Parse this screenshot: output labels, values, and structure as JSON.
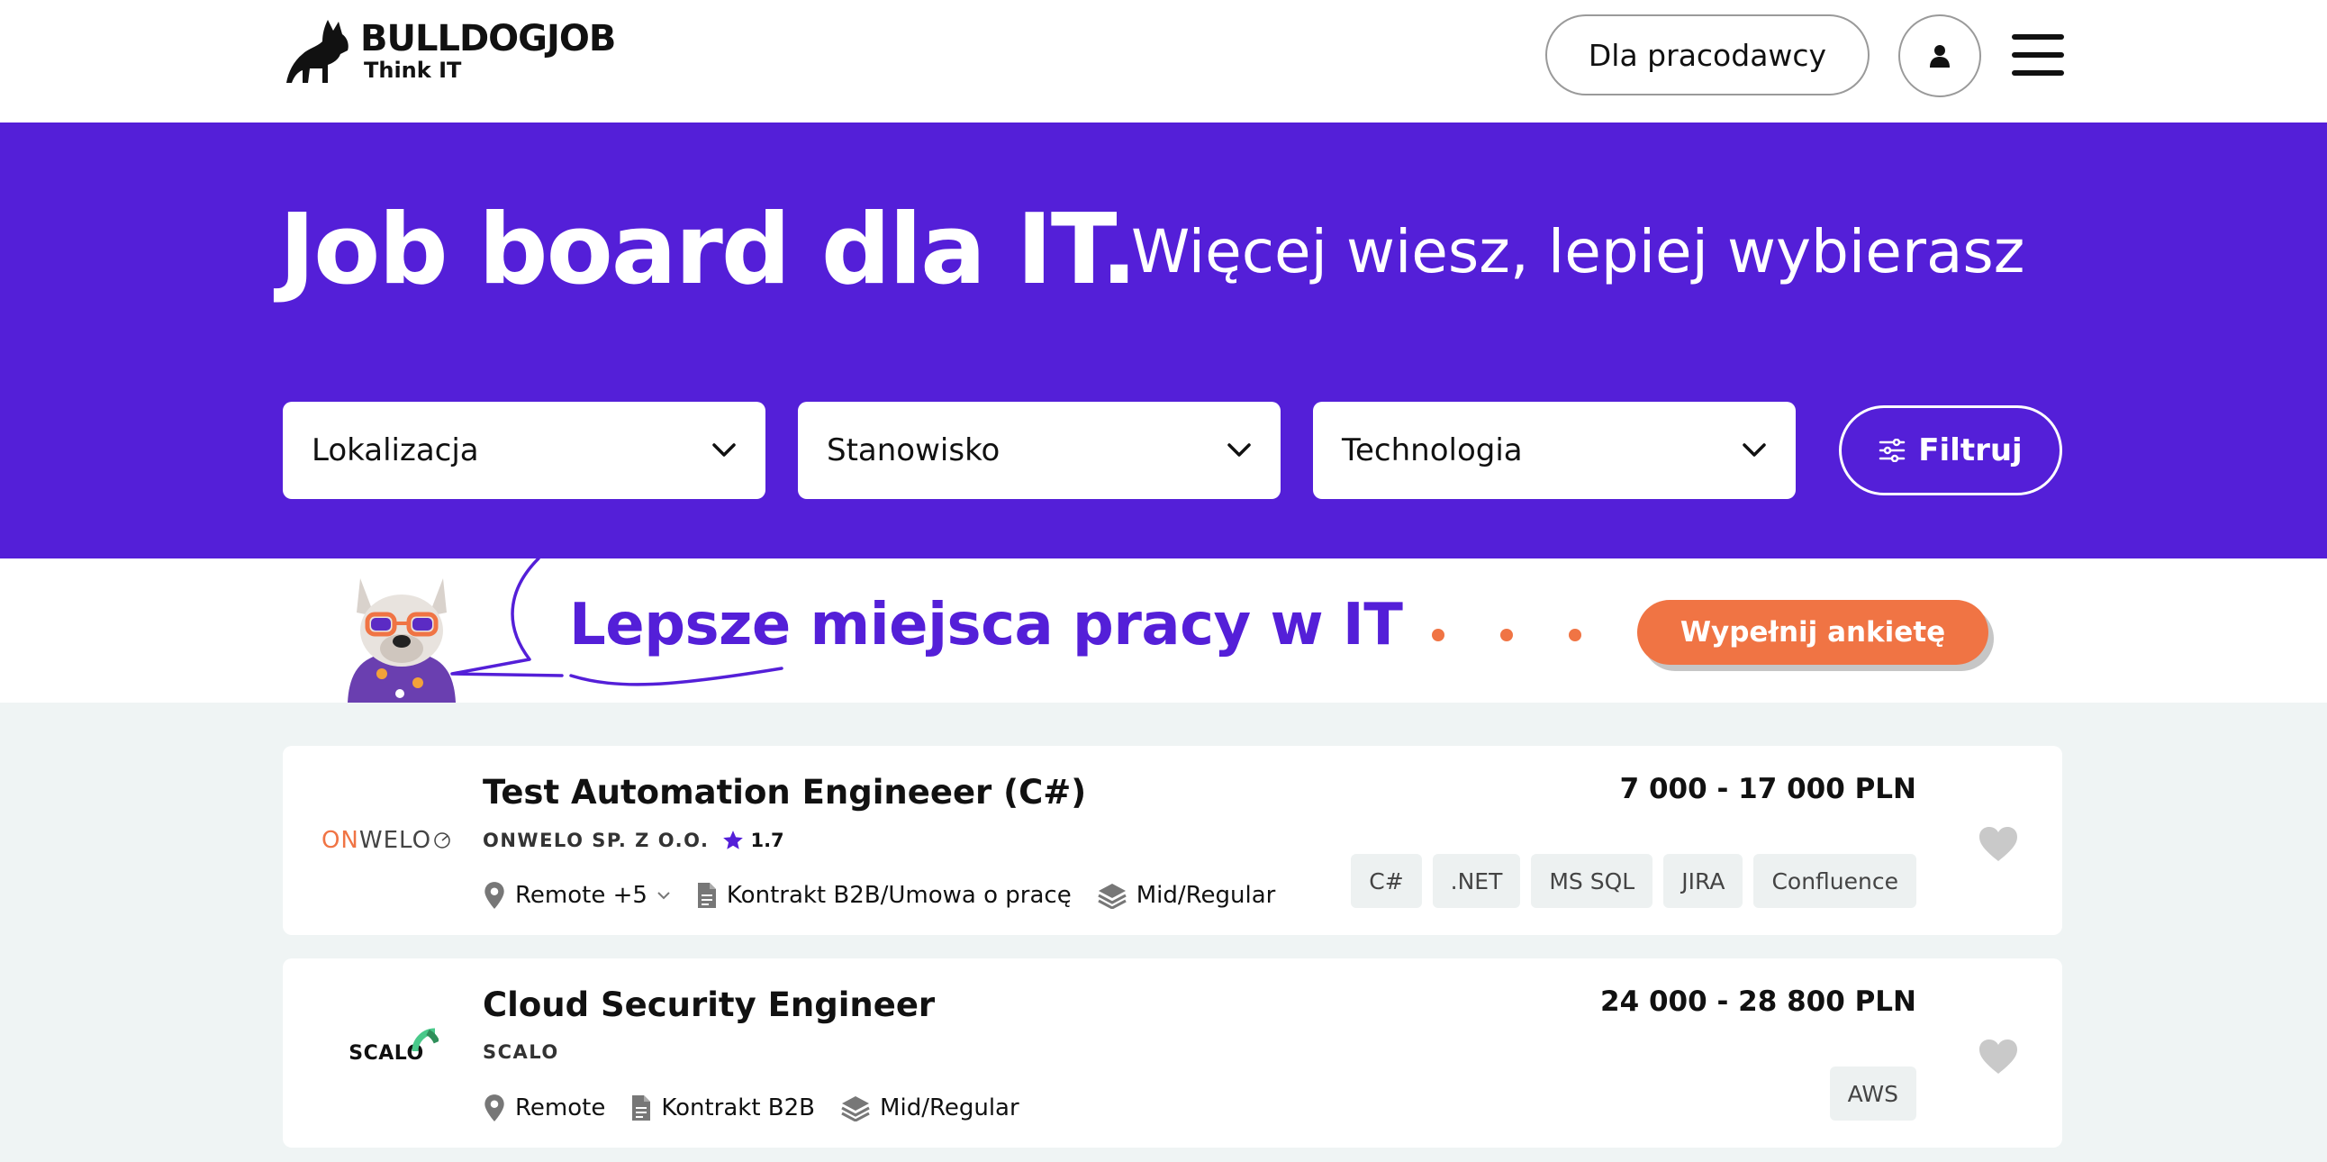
{
  "header": {
    "logo_title": "BULLDOGJOB",
    "logo_subtitle": "Think IT",
    "employer_button": "Dla pracodawcy",
    "user_icon": "user-icon",
    "menu_icon": "hamburger-menu-icon"
  },
  "hero": {
    "title": "Job board dla IT.",
    "subtitle": "Więcej wiesz, lepiej wybierasz",
    "filters": {
      "location": "Lokalizacja",
      "position": "Stanowisko",
      "technology": "Technologia"
    },
    "filter_button": "Filtruj"
  },
  "banner": {
    "text": "Lepsze miejsca pracy w IT",
    "cta": "Wypełnij ankietę"
  },
  "jobs": [
    {
      "title": "Test Automation Engineeer (C#)",
      "company": "ONWELO SP. Z O.O.",
      "company_logo": {
        "prefix": "ON",
        "rest": "WELO"
      },
      "rating": "1.7",
      "location": "Remote +5",
      "contract": "Kontrakt B2B/Umowa o pracę",
      "level": "Mid/Regular",
      "salary": "7 000 - 17 000 PLN",
      "tags": [
        "C#",
        ".NET",
        "MS SQL",
        "JIRA",
        "Confluence"
      ]
    },
    {
      "title": "Cloud Security Engineer",
      "company": "SCALO",
      "company_logo": {
        "text": "SCALO"
      },
      "location": "Remote",
      "contract": "Kontrakt B2B",
      "level": "Mid/Regular",
      "salary": "24 000 - 28 800 PLN",
      "tags": [
        "AWS"
      ]
    }
  ],
  "colors": {
    "brand_purple": "#541fd8",
    "accent_orange": "#f07444",
    "background": "#eff4f4"
  }
}
